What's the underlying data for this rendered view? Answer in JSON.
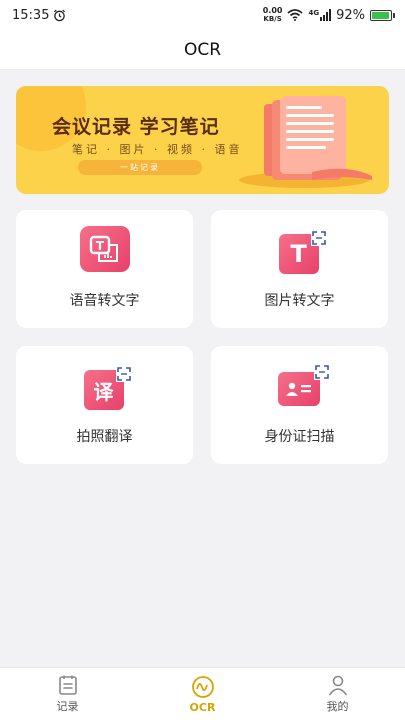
{
  "status": {
    "time": "15:35",
    "net_speed_value": "0.00",
    "net_speed_unit": "KB/S",
    "network_type": "4G",
    "battery": "92%",
    "battery_level": 0.92
  },
  "header": {
    "title": "OCR"
  },
  "banner": {
    "title": "会议记录 学习笔记",
    "subtitle": "笔记 · 图片 · 视频 · 语音",
    "pill": "一站记录"
  },
  "features": [
    {
      "label": "语音转文字",
      "icon": "voice-to-text-icon"
    },
    {
      "label": "图片转文字",
      "icon": "image-to-text-icon"
    },
    {
      "label": "拍照翻译",
      "icon": "photo-translate-icon"
    },
    {
      "label": "身份证扫描",
      "icon": "id-card-scan-icon"
    }
  ],
  "nav": {
    "items": [
      {
        "label": "记录",
        "icon": "notes-icon"
      },
      {
        "label": "OCR",
        "icon": "ocr-icon"
      },
      {
        "label": "我的",
        "icon": "profile-icon"
      }
    ],
    "active_index": 1,
    "active_color": "#d9a400"
  },
  "colors": {
    "accent_pink": "#ec4f72",
    "banner_yellow": "#fcd24a"
  }
}
